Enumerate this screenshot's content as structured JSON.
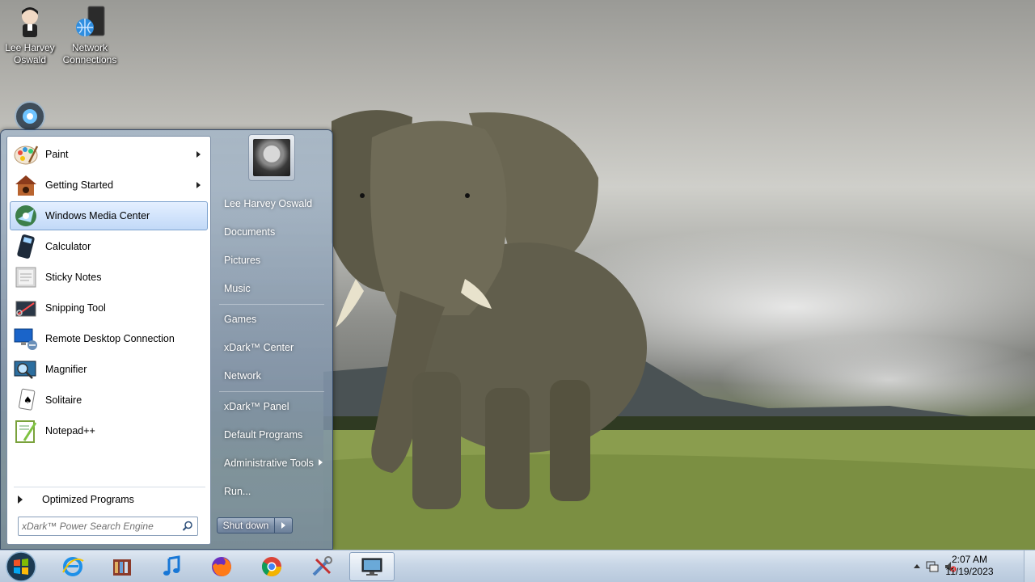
{
  "desktop": {
    "icons": [
      {
        "label": "Lee Harvey\nOswald",
        "icon": "user-folder-icon"
      },
      {
        "label": "Network\nConnections",
        "icon": "network-connections-icon"
      },
      {
        "label": "",
        "icon": "media-icon"
      }
    ]
  },
  "start_menu": {
    "programs": [
      {
        "label": "Paint",
        "icon": "paint-icon",
        "submenu": true
      },
      {
        "label": "Getting Started",
        "icon": "getting-started-icon",
        "submenu": true
      },
      {
        "label": "Windows Media Center",
        "icon": "media-center-icon",
        "submenu": false,
        "highlighted": true
      },
      {
        "label": "Calculator",
        "icon": "calculator-icon",
        "submenu": false
      },
      {
        "label": "Sticky Notes",
        "icon": "sticky-notes-icon",
        "submenu": false
      },
      {
        "label": "Snipping Tool",
        "icon": "snipping-tool-icon",
        "submenu": false
      },
      {
        "label": "Remote Desktop Connection",
        "icon": "remote-desktop-icon",
        "submenu": false
      },
      {
        "label": "Magnifier",
        "icon": "magnifier-icon",
        "submenu": false
      },
      {
        "label": "Solitaire",
        "icon": "solitaire-icon",
        "submenu": false
      },
      {
        "label": "Notepad++",
        "icon": "notepad-plus-plus-icon",
        "submenu": false
      }
    ],
    "all_programs_label": "Optimized Programs",
    "search_placeholder": "xDark™ Power Search Engine",
    "right_items": [
      {
        "label": "Lee Harvey Oswald"
      },
      {
        "label": "Documents"
      },
      {
        "label": "Pictures"
      },
      {
        "label": "Music"
      },
      {
        "label": "Games"
      },
      {
        "label": "xDark™ Center"
      },
      {
        "label": "Network"
      },
      {
        "label": "xDark™ Panel"
      },
      {
        "label": "Default Programs"
      },
      {
        "label": "Administrative Tools",
        "submenu": true
      },
      {
        "label": "Run..."
      }
    ],
    "shutdown_label": "Shut down"
  },
  "taskbar": {
    "pinned": [
      {
        "name": "internet-explorer",
        "icon": "internet-explorer-icon"
      },
      {
        "name": "windows-explorer",
        "icon": "library-icon"
      },
      {
        "name": "media-player",
        "icon": "music-note-icon"
      },
      {
        "name": "firefox",
        "icon": "firefox-icon"
      },
      {
        "name": "chrome",
        "icon": "chrome-icon"
      },
      {
        "name": "tools",
        "icon": "tools-icon"
      },
      {
        "name": "media-center-running",
        "icon": "monitor-icon",
        "active": true
      }
    ],
    "clock": {
      "time": "2:07 AM",
      "date": "11/19/2023"
    }
  }
}
